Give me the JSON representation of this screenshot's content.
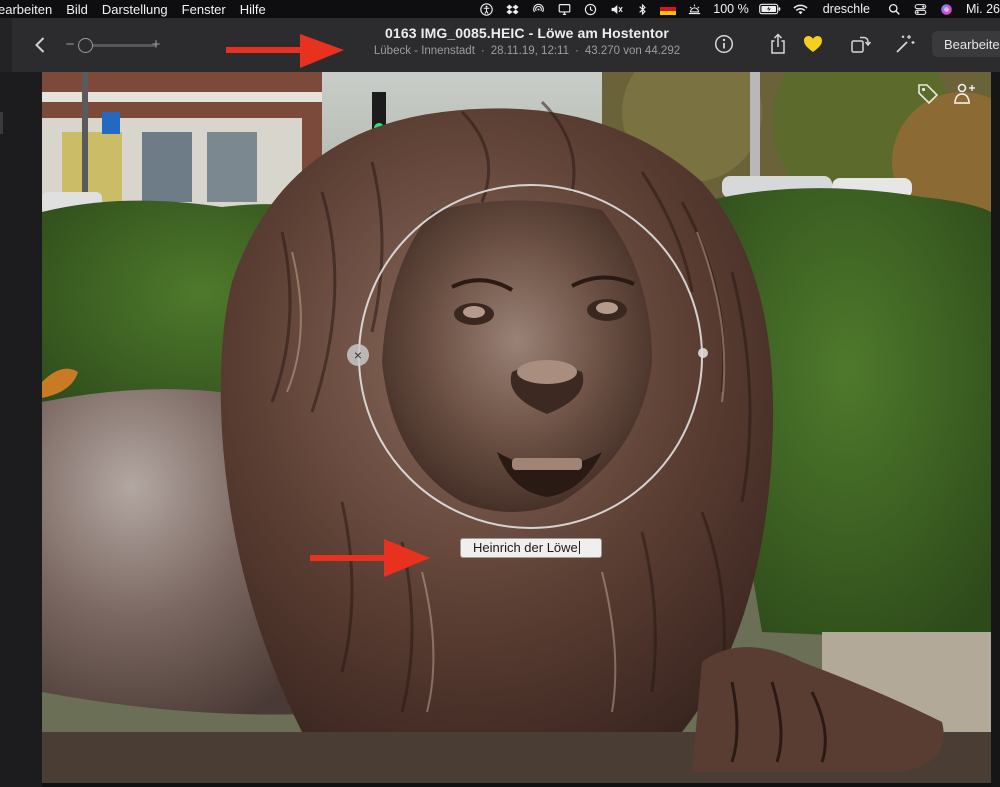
{
  "menubar": {
    "items": [
      "earbeiten",
      "Bild",
      "Darstellung",
      "Fenster",
      "Hilfe"
    ],
    "battery": "100 %",
    "user": "dreschle",
    "clock": "Mi. 26"
  },
  "toolbar": {
    "title": "0163 IMG_0085.HEIC - Löwe am Hostentor",
    "subtitle": {
      "location": "Lübeck - Innenstadt",
      "datetime": "28.11.19, 12:11",
      "position": "43.270 von 44.292"
    },
    "zoom_minus": "−",
    "zoom_plus": "+",
    "edit_label": "Bearbeiten"
  },
  "face": {
    "name_value": "Heinrich der Löwe",
    "remove_glyph": "×"
  },
  "colors": {
    "menubar_bg": "#0e0e10",
    "toolbar_bg": "#2c2c2e",
    "favorite_yellow": "#f5cf1f",
    "annotation_red": "#e8311f"
  },
  "icons": {
    "menubar": [
      "accessibility-icon",
      "dropbox-icon",
      "airdrop-icon",
      "display-icon",
      "time-machine-icon",
      "mute-icon",
      "bluetooth-icon",
      "german-flag-icon",
      "brightness-icon",
      "battery-icon",
      "wifi-icon",
      "search-icon",
      "control-center-icon",
      "siri-icon"
    ],
    "toolbar": [
      "back-icon",
      "info-icon",
      "share-icon",
      "heart-icon",
      "rotate-icon",
      "magic-wand-icon"
    ],
    "photo": [
      "tag-icon",
      "person-icon"
    ]
  }
}
